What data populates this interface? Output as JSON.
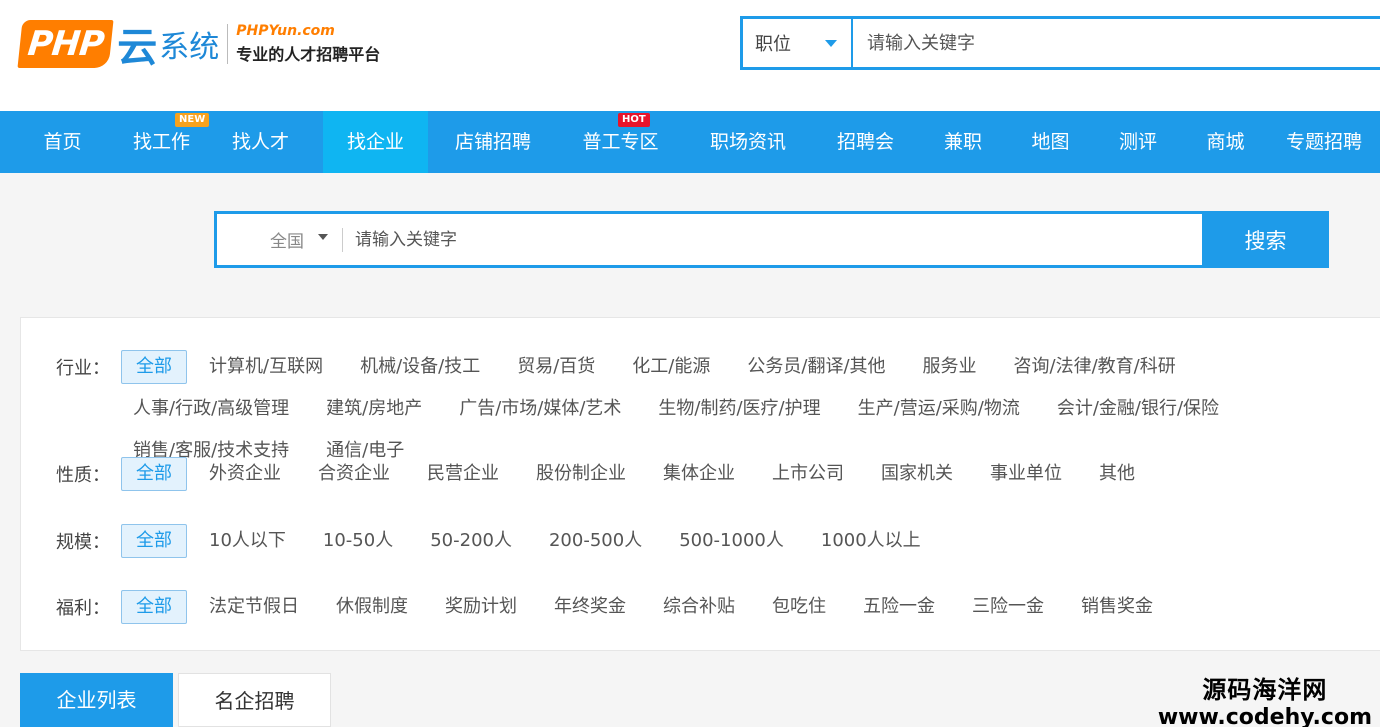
{
  "header": {
    "logo_text_php": "PHP",
    "logo_text_yun": "云",
    "logo_text_system": "系统",
    "logo_site": "PHPYun.com",
    "logo_slogan": "专业的人才招聘平台",
    "search_type": "职位",
    "search_placeholder": "请输入关键字"
  },
  "nav": {
    "items": [
      {
        "label": "首页"
      },
      {
        "label": "找工作",
        "badge": "NEW"
      },
      {
        "label": "找人才"
      },
      {
        "label": "找企业",
        "active": true
      },
      {
        "label": "店铺招聘"
      },
      {
        "label": "普工专区",
        "badge": "HOT"
      },
      {
        "label": "职场资讯"
      },
      {
        "label": "招聘会"
      },
      {
        "label": "兼职"
      },
      {
        "label": "地图"
      },
      {
        "label": "测评"
      },
      {
        "label": "商城"
      },
      {
        "label": "专题招聘"
      }
    ]
  },
  "main_search": {
    "region": "全国",
    "placeholder": "请输入关键字",
    "button": "搜索"
  },
  "filters": {
    "industry": {
      "label": "行业：",
      "options": [
        "全部",
        "计算机/互联网",
        "机械/设备/技工",
        "贸易/百货",
        "化工/能源",
        "公务员/翻译/其他",
        "服务业",
        "咨询/法律/教育/科研",
        "人事/行政/高级管理",
        "建筑/房地产",
        "广告/市场/媒体/艺术",
        "生物/制药/医疗/护理",
        "生产/营运/采购/物流",
        "会计/金融/银行/保险",
        "销售/客服/技术支持",
        "通信/电子"
      ]
    },
    "nature": {
      "label": "性质：",
      "options": [
        "全部",
        "外资企业",
        "合资企业",
        "民营企业",
        "股份制企业",
        "集体企业",
        "上市公司",
        "国家机关",
        "事业单位",
        "其他"
      ]
    },
    "scale": {
      "label": "规模：",
      "options": [
        "全部",
        "10人以下",
        "10-50人",
        "50-200人",
        "200-500人",
        "500-1000人",
        "1000人以上"
      ]
    },
    "welfare": {
      "label": "福利：",
      "options": [
        "全部",
        "法定节假日",
        "休假制度",
        "奖励计划",
        "年终奖金",
        "综合补贴",
        "包吃住",
        "五险一金",
        "三险一金",
        "销售奖金"
      ]
    }
  },
  "tabs": [
    "企业列表",
    "名企招聘"
  ],
  "watermark": {
    "cn": "源码海洋网",
    "en": "www.codehy.com"
  },
  "colors": {
    "primary": "#1e9be9",
    "nav_active": "#0fb5f2",
    "logo_orange": "#ff7e00"
  }
}
